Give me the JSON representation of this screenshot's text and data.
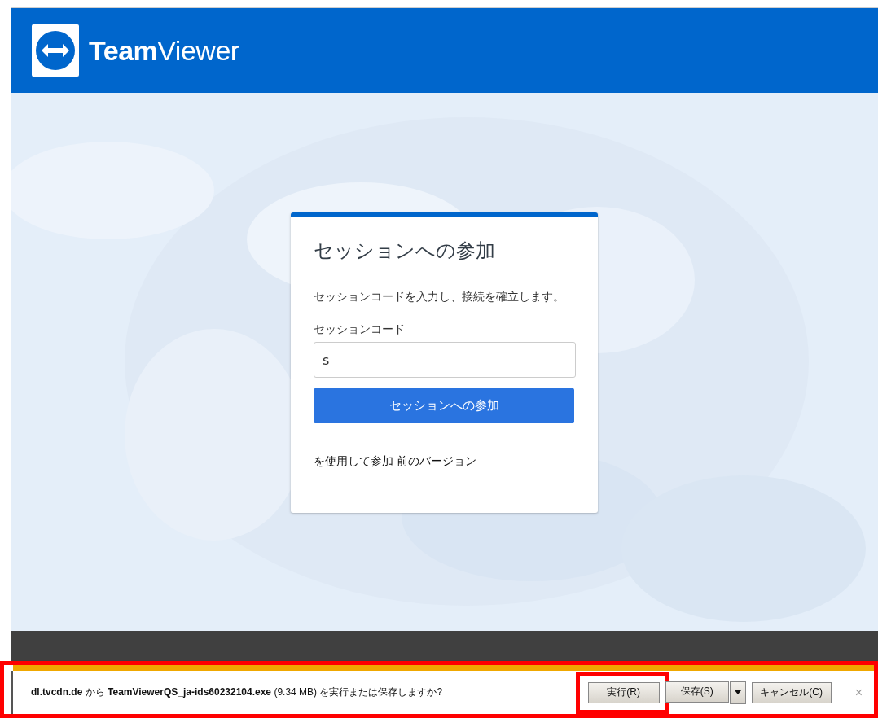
{
  "header": {
    "logo": "**Team**Viewer"
  },
  "card": {
    "title": "セッションへの参加",
    "description": "セッションコードを入力し、接続を確立します。",
    "code_field": {
      "label": "セッションコード",
      "value": "s"
    },
    "join_button": "セッションへの参加",
    "alt_join": {
      "text": "を使用して参加",
      "link": "前のバージョン"
    }
  },
  "download_bar": {
    "highlighted": true,
    "message": "**dl.tvcdn.de** から **TeamViewerQS_ja-ids60232104.exe** (9.34 MB) を実行または保存しますか?",
    "buttons": [
      {
        "label": "実行(R)",
        "kind": "button",
        "highlighted": true
      },
      {
        "label": "保存(S)",
        "kind": "split",
        "highlighted": false
      },
      {
        "label": "キャンセル(C)",
        "kind": "button",
        "highlighted": false
      }
    ],
    "close": "×"
  }
}
